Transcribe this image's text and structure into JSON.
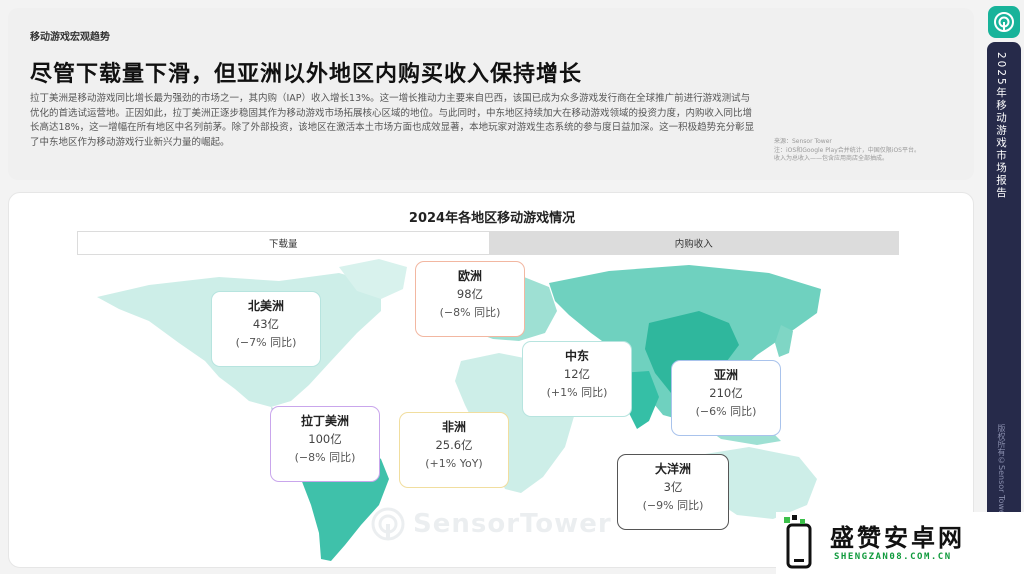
{
  "header": {
    "kicker": "移动游戏宏观趋势",
    "headline": "尽管下载量下滑，但亚洲以外地区内购买收入保持增长",
    "body": "拉丁美洲是移动游戏同比增长最为强劲的市场之一，其内购（IAP）收入增长13%。这一增长推动力主要来自巴西，该国已成为众多游戏发行商在全球推广前进行游戏测试与优化的首选试运营地。正因如此，拉丁美洲正逐步稳固其作为移动游戏市场拓展核心区域的地位。与此同时，中东地区持续加大在移动游戏领域的投资力度，内购收入同比增长高达18%，这一增幅在所有地区中名列前茅。除了外部投资，该地区在激活本土市场方面也成效显著，本地玩家对游戏生态系统的参与度日益加深。这一积极趋势充分彰显了中东地区作为移动游戏行业新兴力量的崛起。",
    "source": "来源：Sensor Tower",
    "source_note1": "注：iOS和Google Play合并统计，中国仅限iOS平台。",
    "source_note2": "收入为总收入——包含应用商店全部抽成。"
  },
  "map_panel": {
    "title": "2024年各地区移动游戏情况",
    "tabs": [
      {
        "label": "下载量",
        "active": true
      },
      {
        "label": "内购收入",
        "active": false
      }
    ],
    "watermark": "SensorTower"
  },
  "regions": [
    {
      "name": "北美洲",
      "value": "43亿",
      "growth": "(−7% 同比)",
      "color": "#b7e4df"
    },
    {
      "name": "欧洲",
      "value": "98亿",
      "growth": "(−8% 同比)",
      "color": "#f2b7a1"
    },
    {
      "name": "中东",
      "value": "12亿",
      "growth": "(+1% 同比)",
      "color": "#b7e4df"
    },
    {
      "name": "亚洲",
      "value": "210亿",
      "growth": "(−6% 同比)",
      "color": "#a9c3ec"
    },
    {
      "name": "拉丁美洲",
      "value": "100亿",
      "growth": "(−8% 同比)",
      "color": "#c9a6ec"
    },
    {
      "name": "非洲",
      "value": "25.6亿",
      "growth": "(+1% YoY)",
      "color": "#f1de9f"
    },
    {
      "name": "大洋洲",
      "value": "3亿",
      "growth": "(−9% 同比)",
      "color": "#555555"
    }
  ],
  "sidebar": {
    "title": "2025年移动游戏市场报告",
    "copyright": "版权所有©Sensor Tower"
  },
  "site_logo": {
    "name": "盛赞安卓网",
    "url": "SHENGZAN08.COM.CN"
  },
  "colors": {
    "map_light": "#cdeee8",
    "map_mid": "#9ee0d3",
    "map_dark": "#35bfa6",
    "rail": "#262a4a",
    "brand": "#18b39a"
  }
}
